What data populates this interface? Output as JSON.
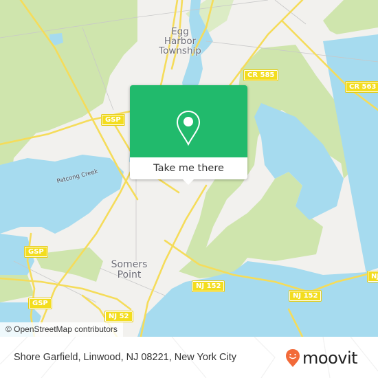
{
  "map": {
    "colors": {
      "land": "#f2f1ee",
      "park": "#cfe5ad",
      "water": "#a6dbef",
      "road_major": "#f5dc5a",
      "road_minor": "#c8c8c8",
      "shield_bg": "#f3dd1e"
    },
    "places": [
      {
        "id": "egg-harbor",
        "label": "Egg\nHarbor\nTownship"
      },
      {
        "id": "somers-point",
        "label": "Somers\nPoint"
      }
    ],
    "water_labels": [
      {
        "id": "patcong-creek",
        "label": "Patcong Creek"
      }
    ],
    "road_shields": [
      {
        "id": "cr585",
        "label": "CR 585"
      },
      {
        "id": "cr563",
        "label": "CR 563"
      },
      {
        "id": "gsp-1",
        "label": "GSP"
      },
      {
        "id": "gsp-2",
        "label": "GSP"
      },
      {
        "id": "gsp-3",
        "label": "GSP"
      },
      {
        "id": "nj152-1",
        "label": "NJ 152"
      },
      {
        "id": "nj152-2",
        "label": "NJ 152"
      },
      {
        "id": "nj152-3",
        "label": "NJ"
      },
      {
        "id": "nj52",
        "label": "NJ 52"
      }
    ],
    "attribution": "© OpenStreetMap contributors"
  },
  "popup": {
    "icon": "map-pin-icon",
    "button_label": "Take me there",
    "accent_color": "#21ba6c"
  },
  "footer": {
    "address": "Shore Garfield, Linwood, NJ 08221, New York City",
    "brand": "moovit",
    "brand_color": "#f26a39"
  }
}
